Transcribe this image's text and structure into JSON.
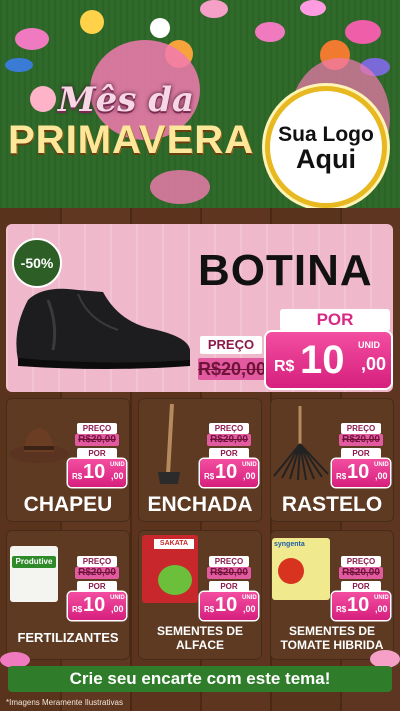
{
  "header": {
    "title_line1": "Mês da",
    "title_line2": "PRIMAVERA",
    "logo_line1": "Sua Logo",
    "logo_line2": "Aqui"
  },
  "featured": {
    "discount": "-50%",
    "name": "BOTINA",
    "preco_label": "PREÇO",
    "old_price": "R$20,00",
    "por_label": "POR",
    "price_currency": "R$",
    "price_int": "10",
    "price_cents": ",00",
    "unit": "UNID"
  },
  "products": [
    {
      "name": "CHAPEU",
      "preco_label": "PREÇO",
      "old_price": "R$20,00",
      "por_label": "POR",
      "currency": "R$",
      "price_int": "10",
      "price_cents": ",00",
      "unit": "UNID"
    },
    {
      "name": "ENCHADA",
      "preco_label": "PREÇO",
      "old_price": "R$20,00",
      "por_label": "POR",
      "currency": "R$",
      "price_int": "10",
      "price_cents": ",00",
      "unit": "UNID"
    },
    {
      "name": "RASTELO",
      "preco_label": "PREÇO",
      "old_price": "R$20,00",
      "por_label": "POR",
      "currency": "R$",
      "price_int": "10",
      "price_cents": ",00",
      "unit": "UNID"
    },
    {
      "name": "FERTILIZANTES",
      "preco_label": "PREÇO",
      "old_price": "R$20,00",
      "por_label": "POR",
      "currency": "R$",
      "price_int": "10",
      "price_cents": ",00",
      "unit": "UNID",
      "package_text": "Produtive"
    },
    {
      "name": "SEMENTES DE ALFACE",
      "preco_label": "PREÇO",
      "old_price": "R$20,00",
      "por_label": "POR",
      "currency": "R$",
      "price_int": "10",
      "price_cents": ",00",
      "unit": "UNID",
      "package_text": "SAKATA"
    },
    {
      "name": "SEMENTES DE TOMATE HIBRIDA",
      "preco_label": "PREÇO",
      "old_price": "R$20,00",
      "por_label": "POR",
      "currency": "R$",
      "price_int": "10",
      "price_cents": ",00",
      "unit": "UNID",
      "package_text": "syngenta"
    }
  ],
  "cta": "Crie seu encarte com este tema!",
  "disclaimer": "*Imagens Meramente Ilustrativas",
  "colors": {
    "pink": "#e0338e",
    "green": "#2f7d2a",
    "wood": "#5a331c"
  }
}
